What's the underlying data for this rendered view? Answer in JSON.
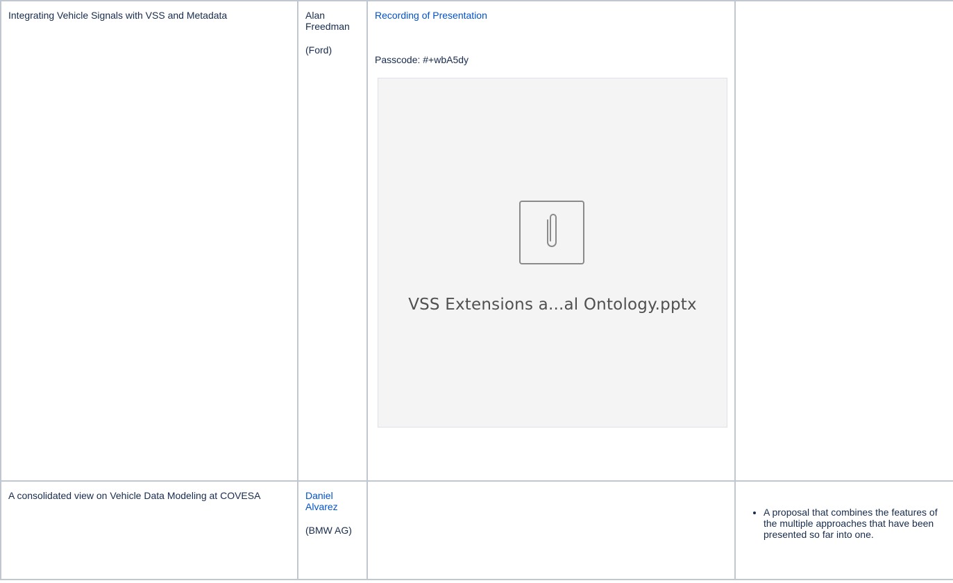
{
  "rows": [
    {
      "title": "Integrating Vehicle Signals with VSS and Metadata",
      "presenter_name": "Alan Freedman",
      "presenter_org": "(Ford)",
      "recording_link": "Recording of Presentation",
      "passcode": "Passcode: #+wbA5dy",
      "attachment": {
        "file_name": "VSS Extensions a...al Ontology.pptx",
        "icon": "paperclip-icon"
      },
      "notes": ""
    },
    {
      "title": "A consolidated view on Vehicle Data Modeling at COVESA",
      "presenter_name": "Daniel Alvarez",
      "presenter_org": "(BMW AG)",
      "notes": "A proposal that combines the features of the multiple approaches that have been presented so far into one."
    }
  ],
  "colors": {
    "link": "#0052cc",
    "border": "#c1c7d0",
    "attachment_bg": "#f4f4f4"
  }
}
